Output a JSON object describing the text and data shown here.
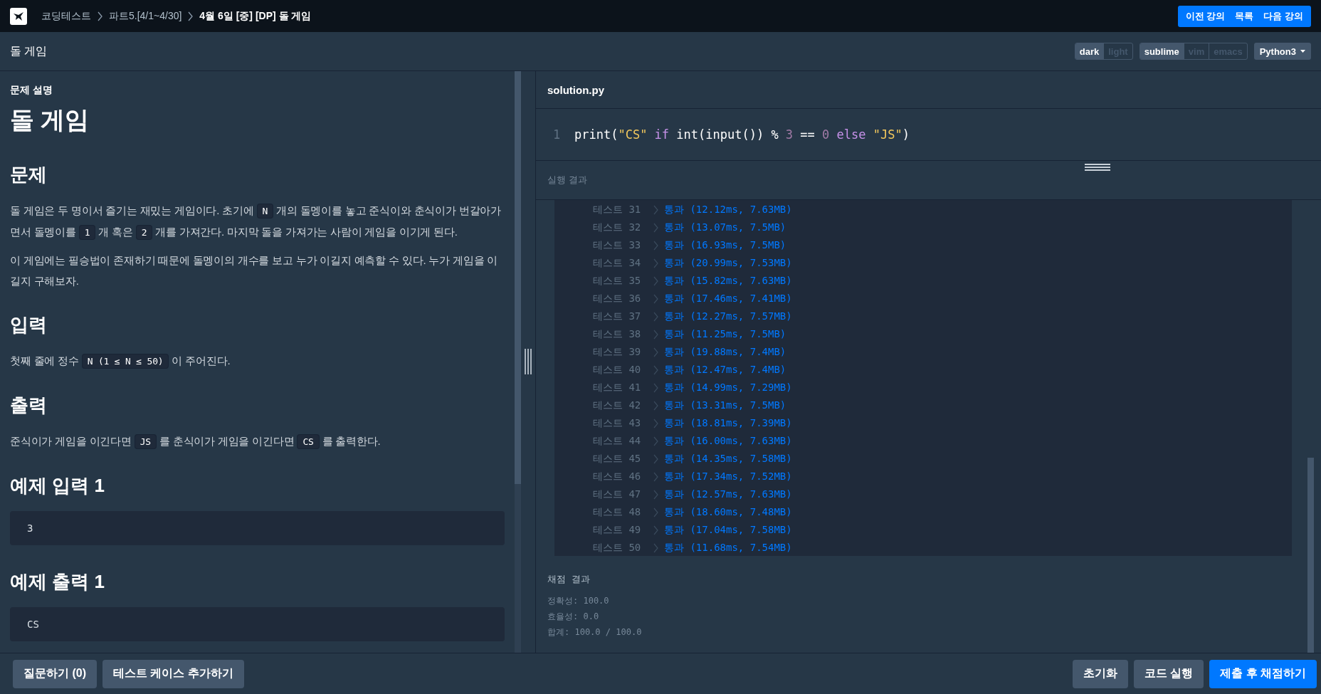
{
  "breadcrumb": {
    "items": [
      "코딩테스트",
      "파트5.[4/1~4/30]",
      "4월 6일 [중] [DP] 돌 게임"
    ]
  },
  "nav_buttons": [
    "이전 강의",
    "목록",
    "다음 강의"
  ],
  "page_title": "돌 게임",
  "theme_toggle": [
    {
      "label": "dark",
      "selected": true
    },
    {
      "label": "light",
      "selected": false
    }
  ],
  "keymap_toggle": [
    {
      "label": "sublime",
      "selected": true
    },
    {
      "label": "vim",
      "selected": false
    },
    {
      "label": "emacs",
      "selected": false
    }
  ],
  "language": "Python3",
  "problem": {
    "section_label": "문제 설명",
    "title": "돌 게임",
    "blocks": [
      {
        "kind": "heading",
        "text": "문제"
      },
      {
        "kind": "paragraph",
        "segments": [
          {
            "kind": "text",
            "text": "돌 게임은 두 명이서 즐기는 재밌는 게임이다. 초기에 "
          },
          {
            "kind": "code",
            "text": "N"
          },
          {
            "kind": "text",
            "text": " 개의 돌멩이를 놓고 준식이와 춘식이가 번갈아가면서 돌멩이를 "
          },
          {
            "kind": "code",
            "text": "1"
          },
          {
            "kind": "text",
            "text": " 개 혹은 "
          },
          {
            "kind": "code",
            "text": "2"
          },
          {
            "kind": "text",
            "text": " 개를 가져간다. 마지막 돌을 가져가는 사람이 게임을 이기게 된다."
          }
        ]
      },
      {
        "kind": "paragraph",
        "segments": [
          {
            "kind": "text",
            "text": "이 게임에는 필승법이 존재하기 때문에 돌멩이의 개수를 보고 누가 이길지 예측할 수 있다. 누가 게임을 이길지 구해보자."
          }
        ]
      },
      {
        "kind": "heading",
        "text": "입력"
      },
      {
        "kind": "paragraph",
        "segments": [
          {
            "kind": "text",
            "text": "첫째 줄에 정수 "
          },
          {
            "kind": "code",
            "text": "N (1 ≤ N ≤ 50)"
          },
          {
            "kind": "text",
            "text": " 이 주어진다."
          }
        ]
      },
      {
        "kind": "heading",
        "text": "출력"
      },
      {
        "kind": "paragraph",
        "segments": [
          {
            "kind": "text",
            "text": "준식이가 게임을 이긴다면 "
          },
          {
            "kind": "code",
            "text": "JS"
          },
          {
            "kind": "text",
            "text": " 를 춘식이가 게임을 이긴다면 "
          },
          {
            "kind": "code",
            "text": "CS"
          },
          {
            "kind": "text",
            "text": " 를 출력한다."
          }
        ]
      },
      {
        "kind": "heading",
        "text": "예제 입력 1"
      },
      {
        "kind": "example",
        "text": "3"
      },
      {
        "kind": "heading",
        "text": "예제 출력 1"
      },
      {
        "kind": "example",
        "text": "CS"
      }
    ]
  },
  "editor": {
    "filename": "solution.py",
    "lines": [
      {
        "number": "1",
        "tokens": [
          {
            "kind": "plain",
            "text": "print("
          },
          {
            "kind": "string",
            "text": "\"CS\""
          },
          {
            "kind": "keyword",
            "text": " if"
          },
          {
            "kind": "plain",
            "text": " int(input()) % "
          },
          {
            "kind": "number",
            "text": "3"
          },
          {
            "kind": "plain",
            "text": " == "
          },
          {
            "kind": "number",
            "text": "0"
          },
          {
            "kind": "keyword",
            "text": " else "
          },
          {
            "kind": "string",
            "text": "\"JS\""
          },
          {
            "kind": "plain",
            "text": ")"
          }
        ]
      }
    ]
  },
  "results": {
    "title": "실행 결과",
    "tests": [
      {
        "label": "테스트 31",
        "result": "통과 (12.12ms, 7.63MB)",
        "passed": true
      },
      {
        "label": "테스트 32",
        "result": "통과 (13.07ms, 7.5MB)",
        "passed": true
      },
      {
        "label": "테스트 33",
        "result": "통과 (16.93ms, 7.5MB)",
        "passed": true
      },
      {
        "label": "테스트 34",
        "result": "통과 (20.99ms, 7.53MB)",
        "passed": true
      },
      {
        "label": "테스트 35",
        "result": "통과 (15.82ms, 7.63MB)",
        "passed": true
      },
      {
        "label": "테스트 36",
        "result": "통과 (17.46ms, 7.41MB)",
        "passed": true
      },
      {
        "label": "테스트 37",
        "result": "통과 (12.27ms, 7.57MB)",
        "passed": true
      },
      {
        "label": "테스트 38",
        "result": "통과 (11.25ms, 7.5MB)",
        "passed": true
      },
      {
        "label": "테스트 39",
        "result": "통과 (19.88ms, 7.4MB)",
        "passed": true
      },
      {
        "label": "테스트 40",
        "result": "통과 (12.47ms, 7.4MB)",
        "passed": true
      },
      {
        "label": "테스트 41",
        "result": "통과 (14.99ms, 7.29MB)",
        "passed": true
      },
      {
        "label": "테스트 42",
        "result": "통과 (13.31ms, 7.5MB)",
        "passed": true
      },
      {
        "label": "테스트 43",
        "result": "통과 (18.81ms, 7.39MB)",
        "passed": true
      },
      {
        "label": "테스트 44",
        "result": "통과 (16.00ms, 7.63MB)",
        "passed": true
      },
      {
        "label": "테스트 45",
        "result": "통과 (14.35ms, 7.58MB)",
        "passed": true
      },
      {
        "label": "테스트 46",
        "result": "통과 (17.34ms, 7.52MB)",
        "passed": true
      },
      {
        "label": "테스트 47",
        "result": "통과 (12.57ms, 7.63MB)",
        "passed": true
      },
      {
        "label": "테스트 48",
        "result": "통과 (18.60ms, 7.48MB)",
        "passed": true
      },
      {
        "label": "테스트 49",
        "result": "통과 (17.04ms, 7.58MB)",
        "passed": true
      },
      {
        "label": "테스트 50",
        "result": "통과 (11.68ms, 7.54MB)",
        "passed": true
      }
    ],
    "score_title": "채점 결과",
    "score_lines": [
      "정확성: 100.0",
      "효율성: 0.0",
      "합계: 100.0 / 100.0"
    ]
  },
  "footer": {
    "left_buttons": [
      "질문하기 (0)",
      "테스트 케이스 추가하기"
    ],
    "right_buttons": [
      {
        "label": "초기화",
        "kind": "secondary"
      },
      {
        "label": "코드 실행",
        "kind": "secondary"
      },
      {
        "label": "제출 후 채점하기",
        "kind": "primary"
      }
    ]
  }
}
